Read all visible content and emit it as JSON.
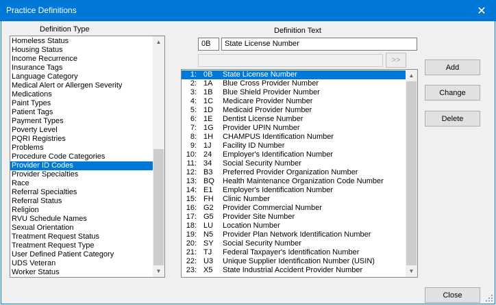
{
  "window": {
    "title": "Practice Definitions",
    "close_glyph": "✕"
  },
  "definition_type": {
    "label": "Definition Type",
    "items": [
      "Homeless Status",
      "Housing Status",
      "Income Recurrence",
      "Insurance Tags",
      "Language Category",
      "Medical Alert or Allergen Severity",
      "Medications",
      "Paint Types",
      "Patient Tags",
      "Payment Types",
      "Poverty Level",
      "PQRI Registries",
      "Problems",
      "Procedure Code Categories",
      "Provider ID Codes",
      "Provider Specialties",
      "Race",
      "Referral Specialties",
      "Referral Status",
      "Religion",
      "RVU Schedule Names",
      "Sexual Orientation",
      "Treatment Request Status",
      "Treatment Request Type",
      "User Defined Patient Category",
      "UDS Veteran",
      "Worker Status"
    ],
    "selected": "Provider ID Codes"
  },
  "definition_text": {
    "label": "Definition Text",
    "code_value": "0B",
    "text_value": "State License Number",
    "secondary_value": "",
    "move_button": ">>"
  },
  "definitions": {
    "rows": [
      {
        "num": "1:",
        "code": "0B",
        "desc": "State License Number"
      },
      {
        "num": "2:",
        "code": "1A",
        "desc": "Blue Cross Provider Number"
      },
      {
        "num": "3:",
        "code": "1B",
        "desc": "Blue Shield Provider Number"
      },
      {
        "num": "4:",
        "code": "1C",
        "desc": "Medicare Provider Number"
      },
      {
        "num": "5:",
        "code": "1D",
        "desc": "Medicaid Provider Number"
      },
      {
        "num": "6:",
        "code": "1E",
        "desc": "Dentist License Number"
      },
      {
        "num": "7:",
        "code": "1G",
        "desc": "Provider UPIN Number"
      },
      {
        "num": "8:",
        "code": "1H",
        "desc": "CHAMPUS Identification Number"
      },
      {
        "num": "9:",
        "code": "1J",
        "desc": "Facility ID Number"
      },
      {
        "num": "10:",
        "code": "24",
        "desc": "Employer's Identification Number"
      },
      {
        "num": "11:",
        "code": "34",
        "desc": "Social Security Number"
      },
      {
        "num": "12:",
        "code": "B3",
        "desc": "Preferred Provider Organization Number"
      },
      {
        "num": "13:",
        "code": "BQ",
        "desc": "Health Maintenance Organization Code Number"
      },
      {
        "num": "14:",
        "code": "E1",
        "desc": "Employer's Identification Number"
      },
      {
        "num": "15:",
        "code": "FH",
        "desc": "Clinic Number"
      },
      {
        "num": "16:",
        "code": "G2",
        "desc": "Provider Commercial Number"
      },
      {
        "num": "17:",
        "code": "G5",
        "desc": "Provider Site Number"
      },
      {
        "num": "18:",
        "code": "LU",
        "desc": "Location Number"
      },
      {
        "num": "19:",
        "code": "N5",
        "desc": "Provider Plan Network Identification Number"
      },
      {
        "num": "20:",
        "code": "SY",
        "desc": "Social Security Number"
      },
      {
        "num": "21:",
        "code": "TJ",
        "desc": "Federal Taxpayer's Identification Number"
      },
      {
        "num": "22:",
        "code": "U3",
        "desc": "Unique Supplier Identification Number (USIN)"
      },
      {
        "num": "23:",
        "code": "X5",
        "desc": "State Industrial Accident Provider Number"
      }
    ],
    "selected_index": 0
  },
  "buttons": {
    "add": "Add",
    "change": "Change",
    "delete": "Delete",
    "close": "Close"
  },
  "colors": {
    "title_bar": "#0078d7",
    "selection": "#0078d7"
  },
  "icons": {
    "scroll_up": "up-arrow-icon",
    "scroll_down": "down-arrow-icon",
    "close": "close-icon",
    "grip": "size-grip-icon"
  }
}
